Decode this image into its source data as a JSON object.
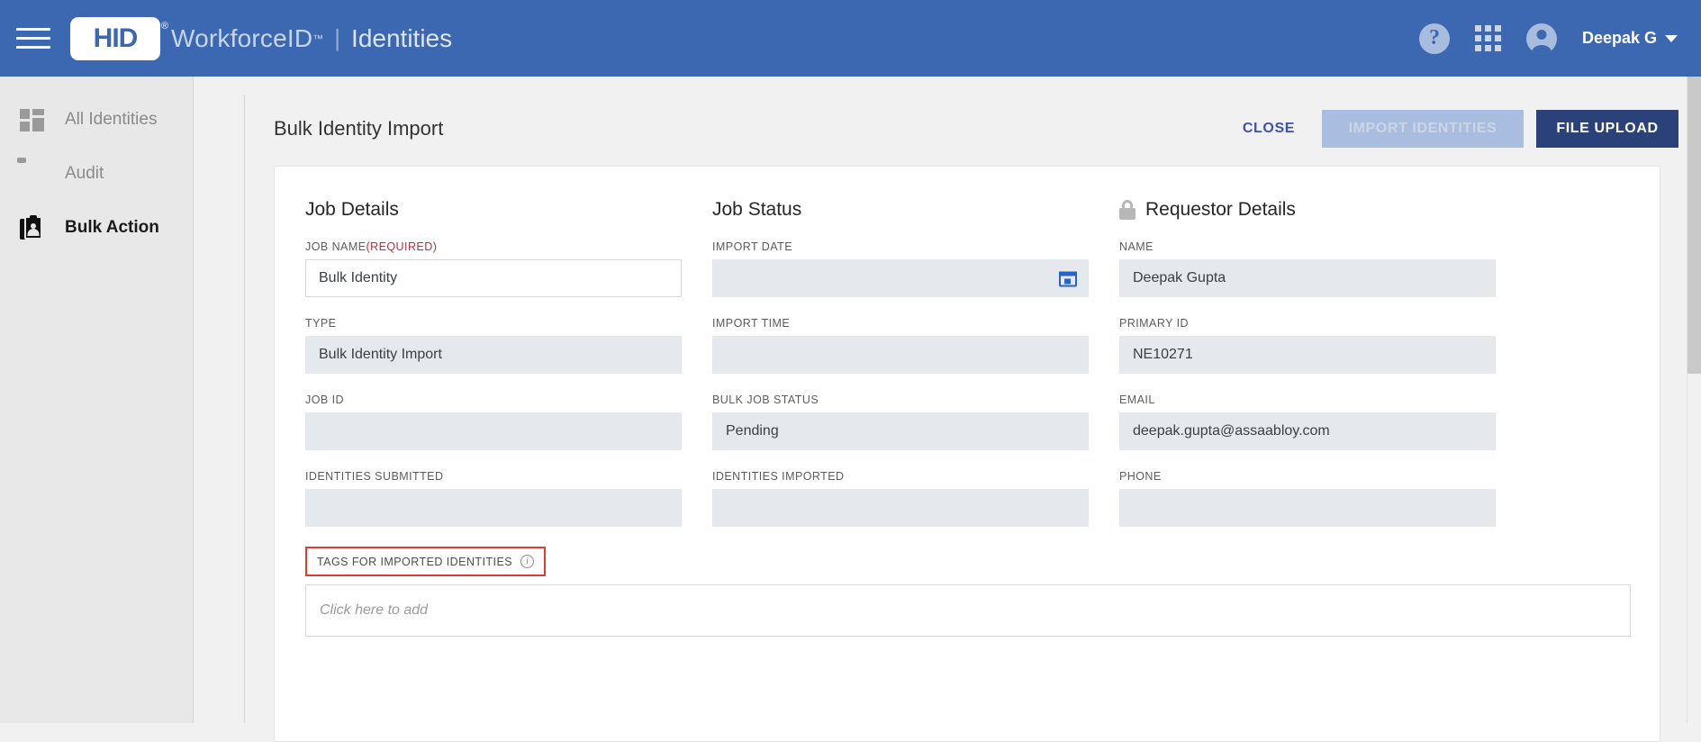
{
  "appbar": {
    "menu_icon": "hamburger-icon",
    "logo_text": "HID",
    "logo_registered": "®",
    "product": "WorkforceID",
    "trademark": "™",
    "separator": "|",
    "section": "Identities",
    "help_icon": "?",
    "apps_icon": "grid-apps-icon",
    "account_icon": "account-circle-icon",
    "user_name": "Deepak G"
  },
  "sidebar": {
    "items": [
      {
        "label": "All Identities",
        "icon": "tiles-icon",
        "active": false
      },
      {
        "label": "Audit",
        "icon": "clipboard-check-icon",
        "active": false
      },
      {
        "label": "Bulk Action",
        "icon": "identity-badge-icon",
        "active": true
      }
    ]
  },
  "toolbar": {
    "page_title": "Bulk Identity Import",
    "close_label": "CLOSE",
    "import_label": "IMPORT IDENTITIES",
    "upload_label": "FILE UPLOAD"
  },
  "job_details": {
    "heading": "Job Details",
    "fields": [
      {
        "label": "JOB NAME",
        "required_suffix": "(Required)",
        "value": "Bulk Identity",
        "readonly": false
      },
      {
        "label": "TYPE",
        "value": "Bulk Identity Import",
        "readonly": true
      },
      {
        "label": "JOB ID",
        "value": "",
        "readonly": true
      },
      {
        "label": "IDENTITIES SUBMITTED",
        "value": "",
        "readonly": true
      }
    ]
  },
  "job_status": {
    "heading": "Job Status",
    "fields": [
      {
        "label": "IMPORT DATE",
        "value": "",
        "readonly": true,
        "icon": "calendar-icon"
      },
      {
        "label": "IMPORT TIME",
        "value": "",
        "readonly": true
      },
      {
        "label": "BULK JOB STATUS",
        "value": "Pending",
        "readonly": true
      },
      {
        "label": "IDENTITIES IMPORTED",
        "value": "",
        "readonly": true
      }
    ]
  },
  "requestor_details": {
    "heading": "Requestor Details",
    "lock_icon": "lock-icon",
    "fields": [
      {
        "label": "NAME",
        "value": "Deepak Gupta",
        "readonly": true
      },
      {
        "label": "PRIMARY ID",
        "value": "NE10271",
        "readonly": true
      },
      {
        "label": "EMAIL",
        "value": "deepak.gupta@assaabloy.com",
        "readonly": true
      },
      {
        "label": "PHONE",
        "value": "",
        "readonly": true
      }
    ]
  },
  "tags": {
    "label": "TAGS FOR IMPORTED IDENTITIES",
    "info_icon": "info-icon",
    "placeholder": "Click here to add",
    "highlight_color": "#e03a33"
  },
  "colors": {
    "header_blue": "#3c67b1",
    "primary_dark": "#2b417a",
    "link_blue": "#3f51b5",
    "readonly_bg": "#e5e9ed",
    "required_red": "#b5303a"
  }
}
